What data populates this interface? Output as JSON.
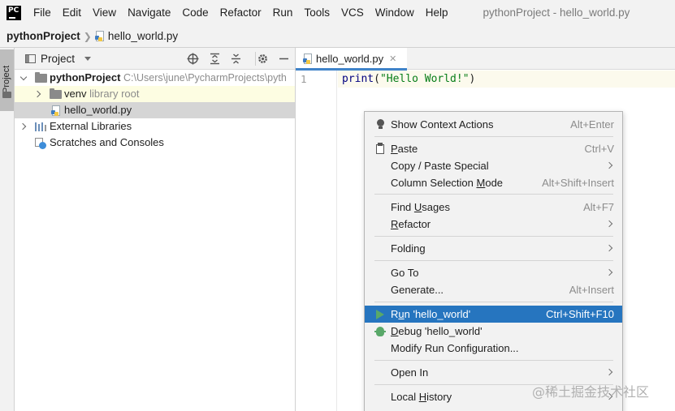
{
  "menubar": {
    "logo": "PC",
    "items": [
      "File",
      "Edit",
      "View",
      "Navigate",
      "Code",
      "Refactor",
      "Run",
      "Tools",
      "VCS",
      "Window",
      "Help"
    ],
    "window_title": "pythonProject - hello_world.py"
  },
  "breadcrumb": {
    "project": "pythonProject",
    "file": "hello_world.py"
  },
  "stripe": {
    "project_tab": "Project"
  },
  "project_panel": {
    "title": "Project",
    "tree": [
      {
        "label": "pythonProject",
        "path": "C:\\Users\\june\\PycharmProjects\\pyth"
      },
      {
        "label": "venv",
        "hint": "library root"
      },
      {
        "label": "hello_world.py"
      },
      {
        "label": "External Libraries"
      },
      {
        "label": "Scratches and Consoles"
      }
    ]
  },
  "editor": {
    "tab_label": "hello_world.py",
    "line_number": "1",
    "code": {
      "fn": "print",
      "open": "(",
      "string": "\"Hello World!\"",
      "close": ")"
    }
  },
  "context_menu": {
    "items": [
      {
        "label": "Show Context Actions",
        "shortcut": "Alt+Enter"
      },
      {
        "label": "Paste",
        "shortcut": "Ctrl+V"
      },
      {
        "label": "Copy / Paste Special",
        "shortcut": ""
      },
      {
        "label": "Column Selection Mode",
        "shortcut": "Alt+Shift+Insert"
      },
      {
        "label": "Find Usages",
        "shortcut": "Alt+F7"
      },
      {
        "label": "Refactor",
        "shortcut": ""
      },
      {
        "label": "Folding",
        "shortcut": ""
      },
      {
        "label": "Go To",
        "shortcut": ""
      },
      {
        "label": "Generate...",
        "shortcut": "Alt+Insert"
      },
      {
        "label": "Run 'hello_world'",
        "shortcut": "Ctrl+Shift+F10"
      },
      {
        "label": "Debug 'hello_world'",
        "shortcut": ""
      },
      {
        "label": "Modify Run Configuration...",
        "shortcut": ""
      },
      {
        "label": "Open In",
        "shortcut": ""
      },
      {
        "label": "Local History",
        "shortcut": ""
      }
    ],
    "selected": "Run 'hello_world'"
  },
  "watermark": "@稀土掘金技术社区",
  "colors": {
    "selection": "#2675bf",
    "tab_accent": "#4083c9",
    "run_green": "#59a869",
    "string_green": "#067d17",
    "keyword_navy": "#000080",
    "library_root_bg": "#fdfde2"
  },
  "icons": [
    "pycharm-logo-icon",
    "python-file-icon",
    "folder-icon",
    "external-libraries-icon",
    "scratches-icon",
    "lightbulb-icon",
    "clipboard-icon",
    "run-icon",
    "debug-icon",
    "globe-icon",
    "expand-all-icon",
    "collapse-all-icon",
    "gear-icon",
    "minimize-icon"
  ]
}
